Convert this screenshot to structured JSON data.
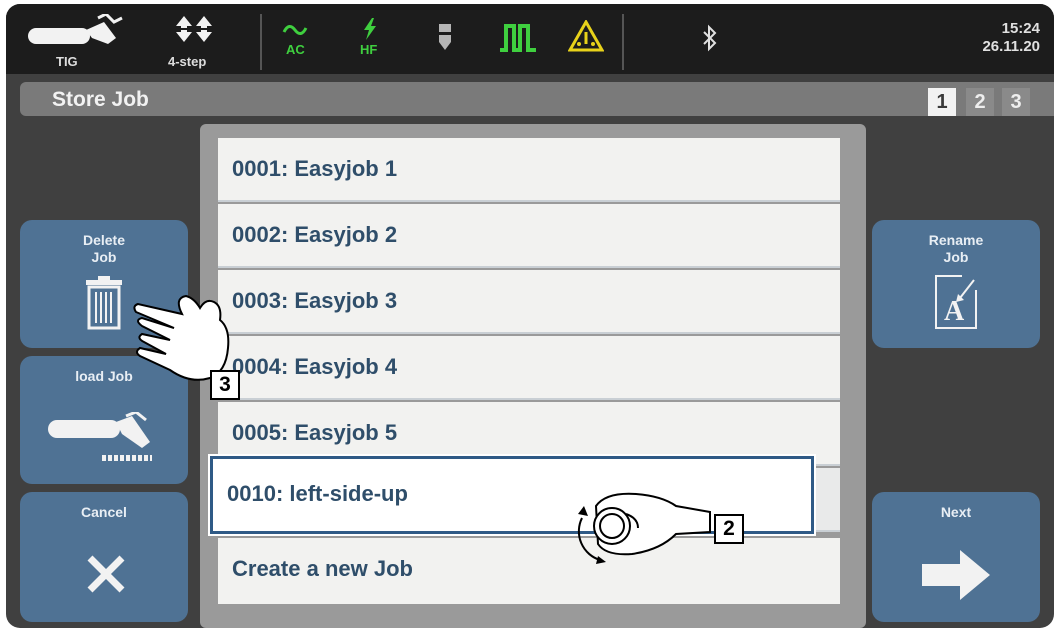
{
  "status_bar": {
    "process": "TIG",
    "mode": "4-step",
    "ac_label": "AC",
    "hf_label": "HF",
    "time": "15:24",
    "date": "26.11.20",
    "icons": [
      "torch-icon",
      "up-down-arrows-icon",
      "ac-wave-icon",
      "hf-bolt-icon",
      "electrode-icon",
      "pulse-icon",
      "warning-icon",
      "bluetooth-icon"
    ]
  },
  "header": {
    "title": "Store Job",
    "pages": [
      "1",
      "2",
      "3"
    ],
    "active_page": "1"
  },
  "buttons": {
    "delete_line1": "Delete",
    "delete_line2": "Job",
    "load": "load Job",
    "cancel": "Cancel",
    "rename_line1": "Rename",
    "rename_line2": "Job",
    "next": "Next"
  },
  "jobs": [
    {
      "label": "0001: Easyjob 1"
    },
    {
      "label": "0002: Easyjob 2"
    },
    {
      "label": "0003: Easyjob 3"
    },
    {
      "label": "0004: Easyjob 4"
    },
    {
      "label": "0005: Easyjob 5"
    },
    {
      "label": "0010: left-side-up"
    },
    {
      "label": "Create a new Job"
    }
  ],
  "selected_job": "0010: left-side-up",
  "callouts": {
    "knob": "2",
    "tap": "3"
  },
  "colors": {
    "button": "#4f7294",
    "selection_border": "#2f5a86",
    "status_green": "#3fcf3f",
    "warning_yellow": "#e8d21a"
  }
}
